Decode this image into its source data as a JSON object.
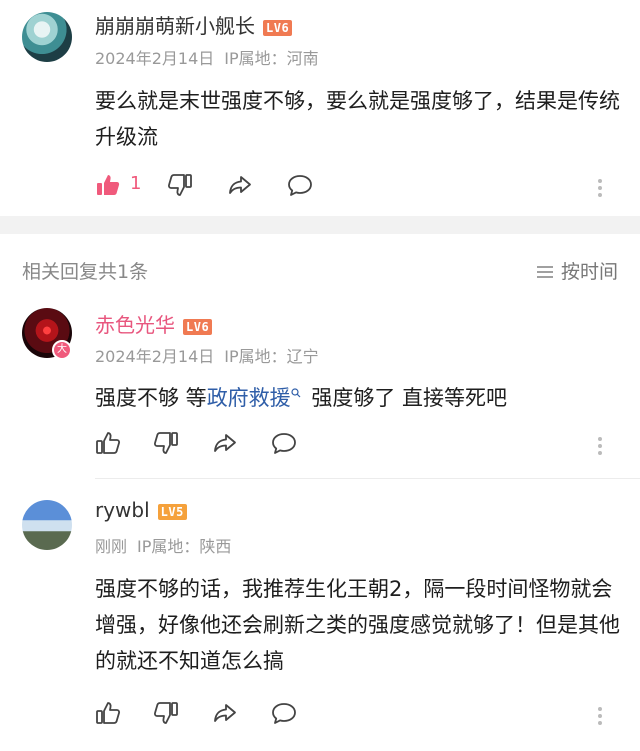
{
  "main_comment": {
    "username": "崩崩崩萌新小舰长",
    "level": "LV6",
    "date": "2024年2月14日",
    "ip_location": "IP属地：河南",
    "text": "要么就是末世强度不够，要么就是强度够了，结果是传统升级流",
    "like_count": "1"
  },
  "replies_header": {
    "title": "相关回复共1条",
    "sort_label": "按时间"
  },
  "replies": [
    {
      "username": "赤色光华",
      "level": "LV6",
      "avatar_badge": "大",
      "date": "2024年2月14日",
      "ip_location": "IP属地：辽宁",
      "text_before": "强度不够 等",
      "link_text": "政府救援",
      "text_after": " 强度够了 直接等死吧"
    },
    {
      "username": "rywbl",
      "level": "LV5",
      "date": "刚刚",
      "ip_location": "IP属地：陕西",
      "text": "强度不够的话，我推荐生化王朝2，隔一段时间怪物就会增强，好像他还会刷新之类的强度感觉就够了！但是其他的就还不知道怎么搞"
    }
  ],
  "colors": {
    "accent_pink": "#f05a7c",
    "link_blue": "#2f5ea8"
  }
}
